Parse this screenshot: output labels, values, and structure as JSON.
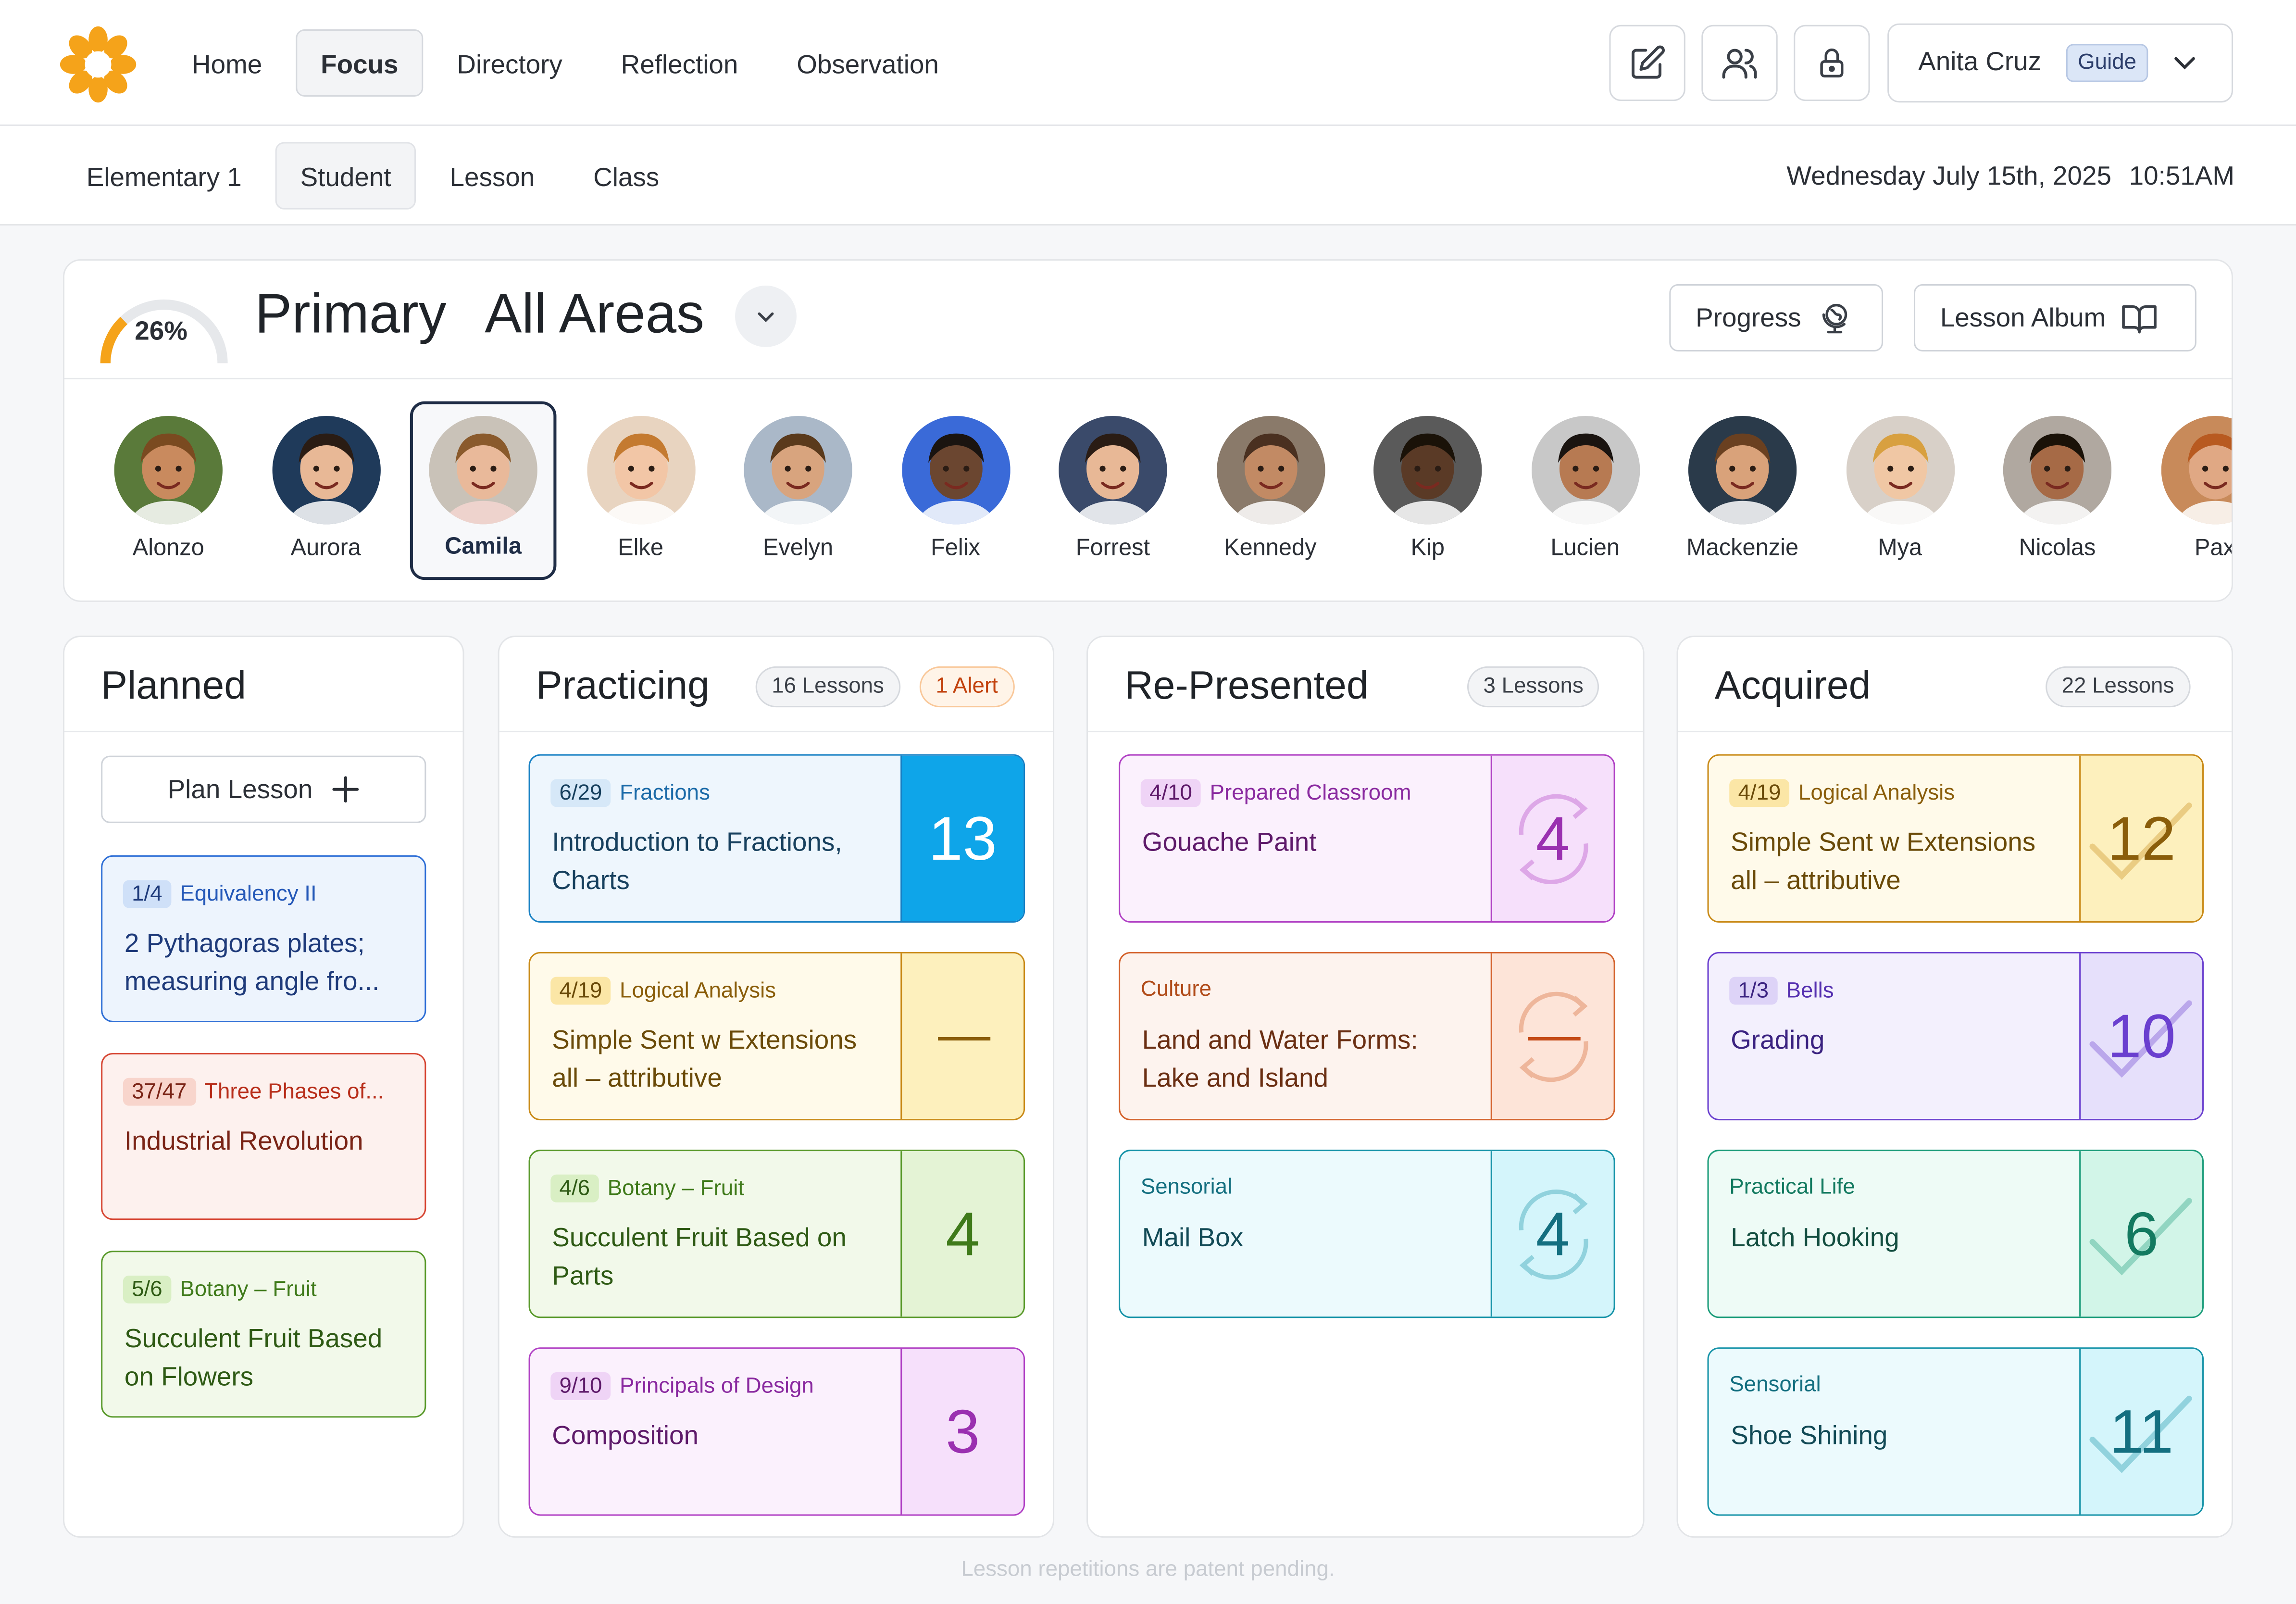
{
  "nav": {
    "items": [
      "Home",
      "Focus",
      "Directory",
      "Reflection",
      "Observation"
    ],
    "active": "Focus"
  },
  "toolbar_icons": [
    "edit-icon",
    "users-icon",
    "lock-icon"
  ],
  "user": {
    "name": "Anita Cruz",
    "role": "Guide"
  },
  "subnav": {
    "items": [
      "Elementary 1",
      "Student",
      "Lesson",
      "Class"
    ],
    "active": "Student"
  },
  "datetime": {
    "date": "Wednesday July 15th, 2025",
    "time": "10:51AM"
  },
  "summary": {
    "progress_label": "26%",
    "progress_value": 0.26,
    "level": "Primary",
    "area": "All Areas",
    "progress_button": "Progress",
    "album_button": "Lesson Album"
  },
  "students": [
    {
      "name": "Alonzo"
    },
    {
      "name": "Aurora"
    },
    {
      "name": "Camila",
      "selected": true
    },
    {
      "name": "Elke"
    },
    {
      "name": "Evelyn"
    },
    {
      "name": "Felix"
    },
    {
      "name": "Forrest"
    },
    {
      "name": "Kennedy"
    },
    {
      "name": "Kip"
    },
    {
      "name": "Lucien"
    },
    {
      "name": "Mackenzie"
    },
    {
      "name": "Mya"
    },
    {
      "name": "Nicolas"
    },
    {
      "name": "Pax"
    }
  ],
  "columns": {
    "planned": {
      "title": "Planned",
      "plan_button": "Plan Lesson",
      "cards": [
        {
          "badge": "1/4",
          "area": "Equivalency II",
          "title": "2 Pythagoras plates; measuring angle fro...",
          "color": "blue"
        },
        {
          "badge": "37/47",
          "area": "Three Phases of...",
          "title": "Industrial Revolution",
          "color": "red"
        },
        {
          "badge": "5/6",
          "area": "Botany – Fruit",
          "title": "Succulent Fruit Based on Flowers",
          "color": "green"
        }
      ]
    },
    "practicing": {
      "title": "Practicing",
      "count": "16 Lessons",
      "alert": "1 Alert",
      "cards": [
        {
          "badge": "6/29",
          "area": "Fractions",
          "title": "Introduction to Fractions, Charts",
          "count": "13",
          "color": "sky"
        },
        {
          "badge": "4/19",
          "area": "Logical Analysis",
          "title": "Simple Sent w Extensions all – attributive",
          "count": "––",
          "color": "yellow"
        },
        {
          "badge": "4/6",
          "area": "Botany – Fruit",
          "title": "Succulent Fruit Based on Parts",
          "count": "4",
          "color": "green"
        },
        {
          "badge": "9/10",
          "area": "Principals of Design",
          "title": "Composition",
          "count": "3",
          "color": "purple"
        }
      ]
    },
    "represented": {
      "title": "Re-Presented",
      "count": "3 Lessons",
      "cards": [
        {
          "badge": "4/10",
          "area": "Prepared Classroom",
          "title": "Gouache Paint",
          "count": "4",
          "color": "purple"
        },
        {
          "badge": "",
          "area": "Culture",
          "title": "Land and Water Forms: Lake and Island",
          "count": "––",
          "color": "orange"
        },
        {
          "badge": "",
          "area": "Sensorial",
          "title": "Mail Box",
          "count": "4",
          "color": "cyan"
        }
      ]
    },
    "acquired": {
      "title": "Acquired",
      "count": "22 Lessons",
      "cards": [
        {
          "badge": "4/19",
          "area": "Logical Analysis",
          "title": "Simple Sent w Extensions all – attributive",
          "count": "12",
          "color": "yellow"
        },
        {
          "badge": "1/3",
          "area": "Bells",
          "title": "Grading",
          "count": "10",
          "color": "violet"
        },
        {
          "badge": "",
          "area": "Practical Life",
          "title": "Latch Hooking",
          "count": "6",
          "color": "teal"
        },
        {
          "badge": "",
          "area": "Sensorial",
          "title": "Shoe Shining",
          "count": "11",
          "color": "cyan"
        }
      ]
    }
  },
  "footnote": "Lesson repetitions are patent pending.",
  "colors": {
    "accent_orange": "#f5a31a",
    "selected_border": "#1f2d46",
    "sky_fill": "#0ea5e9"
  }
}
